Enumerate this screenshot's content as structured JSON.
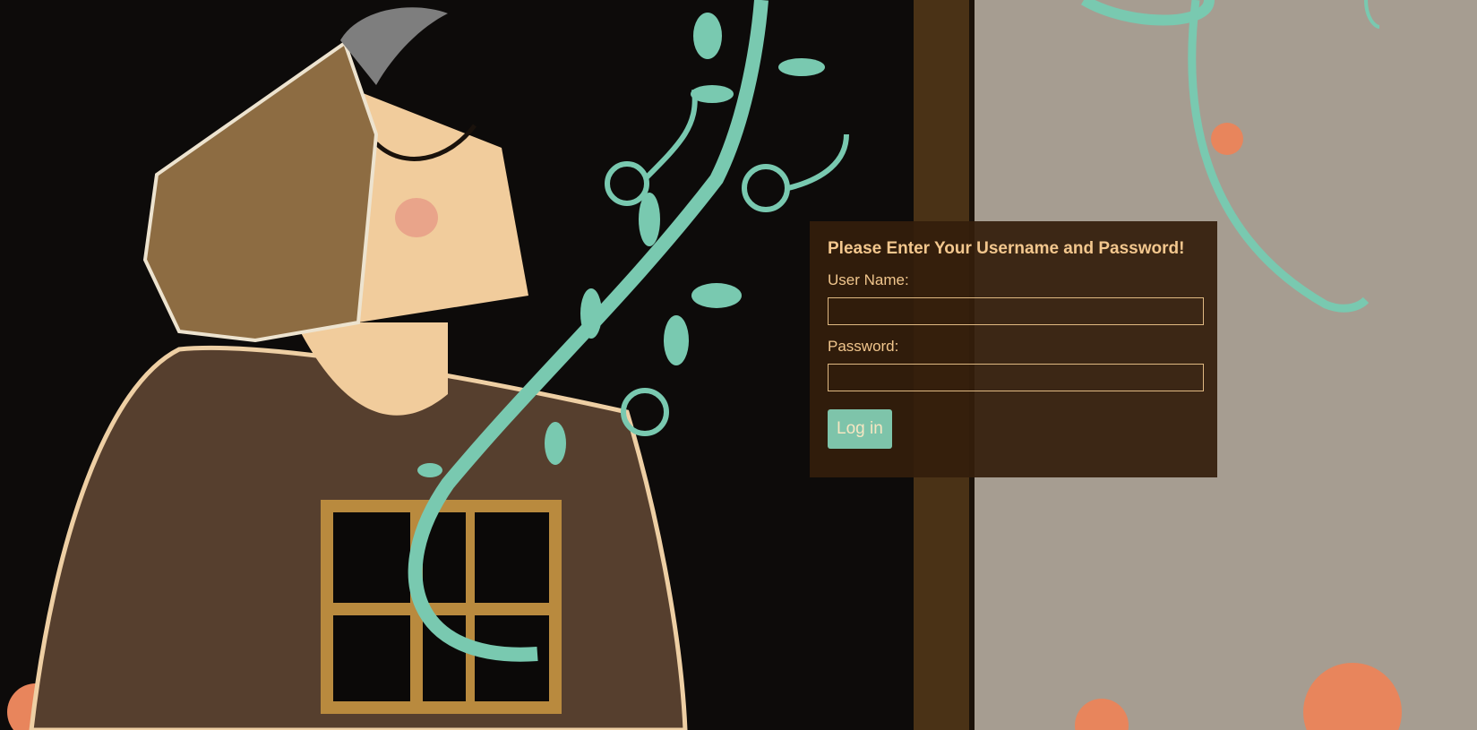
{
  "login": {
    "title": "Please Enter Your Username and Password!",
    "username_label": "User Name:",
    "username_value": "",
    "password_label": "Password:",
    "password_value": "",
    "submit_label": "Log in"
  },
  "colors": {
    "panel_bg": "#341e0c",
    "panel_text": "#f1c68d",
    "button_bg": "#7ec4aa",
    "button_text": "#f6e6c2"
  },
  "background": {
    "description_icon": "illustration-woman-vine-window"
  }
}
